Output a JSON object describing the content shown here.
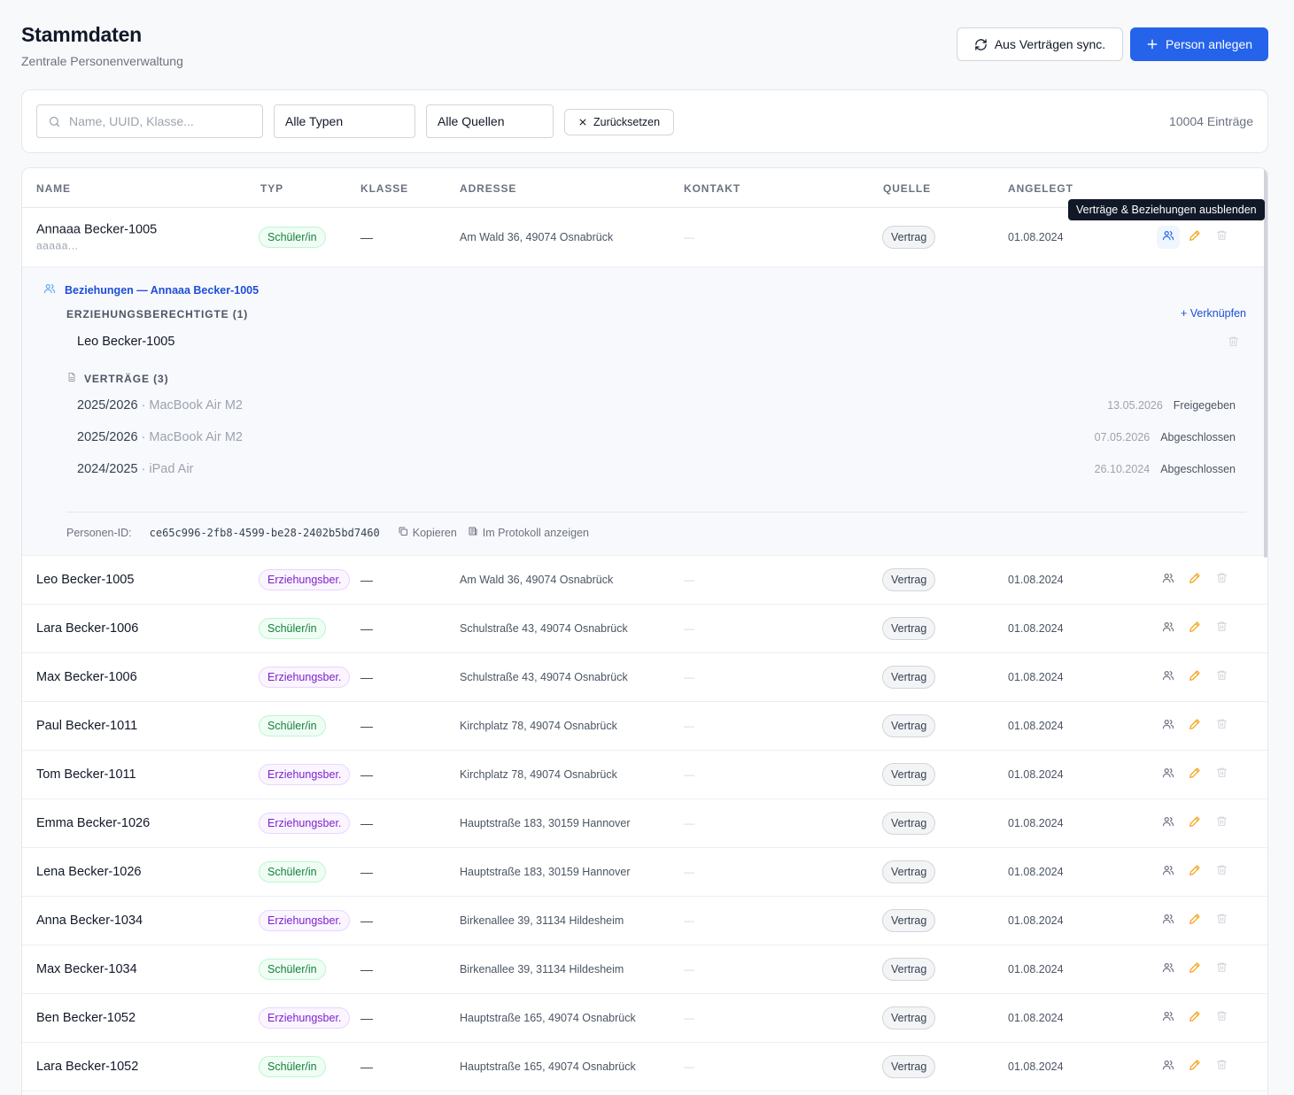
{
  "page": {
    "title": "Stammdaten",
    "subtitle": "Zentrale Personenverwaltung"
  },
  "toolbar": {
    "sync_label": "Aus Verträgen sync.",
    "add_label": "Person anlegen"
  },
  "filters": {
    "search_placeholder": "Name, UUID, Klasse...",
    "typ_selected": "Alle Typen",
    "quelle_selected": "Alle Quellen",
    "reset_label": "Zurücksetzen",
    "count_label": "10004 Einträge"
  },
  "table": {
    "headers": {
      "name": "NAME",
      "typ": "TYP",
      "klasse": "KLASSE",
      "adresse": "ADRESSE",
      "kontakt": "KONTAKT",
      "quelle": "QUELLE",
      "angelegt": "ANGELEGT"
    },
    "tooltip": "Verträge & Beziehungen ausblenden",
    "rows": [
      {
        "name": "Annaaa Becker-1005",
        "sub": "aaaaa...",
        "typ": "Schüler/in",
        "typ_kind": "s",
        "klasse": "—",
        "adresse": "Am Wald 36, 49074 Osnabrück",
        "kontakt": "—",
        "quelle": "Vertrag",
        "angelegt": "01.08.2024"
      },
      {
        "name": "Leo Becker-1005",
        "typ": "Erziehungsber.",
        "typ_kind": "e",
        "klasse": "—",
        "adresse": "Am Wald 36, 49074 Osnabrück",
        "kontakt": "—",
        "quelle": "Vertrag",
        "angelegt": "01.08.2024"
      },
      {
        "name": "Lara Becker-1006",
        "typ": "Schüler/in",
        "typ_kind": "s",
        "klasse": "—",
        "adresse": "Schulstraße 43, 49074 Osnabrück",
        "kontakt": "—",
        "quelle": "Vertrag",
        "angelegt": "01.08.2024"
      },
      {
        "name": "Max Becker-1006",
        "typ": "Erziehungsber.",
        "typ_kind": "e",
        "klasse": "—",
        "adresse": "Schulstraße 43, 49074 Osnabrück",
        "kontakt": "—",
        "quelle": "Vertrag",
        "angelegt": "01.08.2024"
      },
      {
        "name": "Paul Becker-1011",
        "typ": "Schüler/in",
        "typ_kind": "s",
        "klasse": "—",
        "adresse": "Kirchplatz 78, 49074 Osnabrück",
        "kontakt": "—",
        "quelle": "Vertrag",
        "angelegt": "01.08.2024"
      },
      {
        "name": "Tom Becker-1011",
        "typ": "Erziehungsber.",
        "typ_kind": "e",
        "klasse": "—",
        "adresse": "Kirchplatz 78, 49074 Osnabrück",
        "kontakt": "—",
        "quelle": "Vertrag",
        "angelegt": "01.08.2024"
      },
      {
        "name": "Emma Becker-1026",
        "typ": "Erziehungsber.",
        "typ_kind": "e",
        "klasse": "—",
        "adresse": "Hauptstraße 183, 30159 Hannover",
        "kontakt": "—",
        "quelle": "Vertrag",
        "angelegt": "01.08.2024"
      },
      {
        "name": "Lena Becker-1026",
        "typ": "Schüler/in",
        "typ_kind": "s",
        "klasse": "—",
        "adresse": "Hauptstraße 183, 30159 Hannover",
        "kontakt": "—",
        "quelle": "Vertrag",
        "angelegt": "01.08.2024"
      },
      {
        "name": "Anna Becker-1034",
        "typ": "Erziehungsber.",
        "typ_kind": "e",
        "klasse": "—",
        "adresse": "Birkenallee 39, 31134 Hildesheim",
        "kontakt": "—",
        "quelle": "Vertrag",
        "angelegt": "01.08.2024"
      },
      {
        "name": "Max Becker-1034",
        "typ": "Schüler/in",
        "typ_kind": "s",
        "klasse": "—",
        "adresse": "Birkenallee 39, 31134 Hildesheim",
        "kontakt": "—",
        "quelle": "Vertrag",
        "angelegt": "01.08.2024"
      },
      {
        "name": "Ben Becker-1052",
        "typ": "Erziehungsber.",
        "typ_kind": "e",
        "klasse": "—",
        "adresse": "Hauptstraße 165, 49074 Osnabrück",
        "kontakt": "—",
        "quelle": "Vertrag",
        "angelegt": "01.08.2024"
      },
      {
        "name": "Lara Becker-1052",
        "typ": "Schüler/in",
        "typ_kind": "s",
        "klasse": "—",
        "adresse": "Hauptstraße 165, 49074 Osnabrück",
        "kontakt": "—",
        "quelle": "Vertrag",
        "angelegt": "01.08.2024"
      }
    ]
  },
  "detail": {
    "title": "Beziehungen — Annaaa Becker-1005",
    "guardians_label": "ERZIEHUNGSBERECHTIGTE (1)",
    "link_label": "+ Verknüpfen",
    "guardians": [
      "Leo Becker-1005"
    ],
    "contracts_label": "VERTRÄGE (3)",
    "contracts": [
      {
        "year": "2025/2026",
        "device": "· MacBook Air M2",
        "date": "13.05.2026",
        "status": "Freigegeben"
      },
      {
        "year": "2025/2026",
        "device": "· MacBook Air M2",
        "date": "07.05.2026",
        "status": "Abgeschlossen"
      },
      {
        "year": "2024/2025",
        "device": "· iPad Air",
        "date": "26.10.2024",
        "status": "Abgeschlossen"
      }
    ],
    "pid_label": "Personen-ID:",
    "pid_value": "ce65c996-2fb8-4599-be28-2402b5bd7460",
    "copy_label": "Kopieren",
    "log_label": "Im Protokoll anzeigen"
  },
  "icons": {
    "search": "search-icon",
    "sync": "refresh-icon",
    "add": "plus-icon",
    "reset": "close-icon",
    "relations": "users-icon",
    "edit": "pencil-icon",
    "delete": "trash-icon",
    "contracts": "document-icon",
    "copy": "copy-icon",
    "log": "log-icon"
  },
  "colors": {
    "primary": "#2563eb",
    "student": "#15803d",
    "guardian": "#7e22ce",
    "edit": "#f59e0b"
  }
}
